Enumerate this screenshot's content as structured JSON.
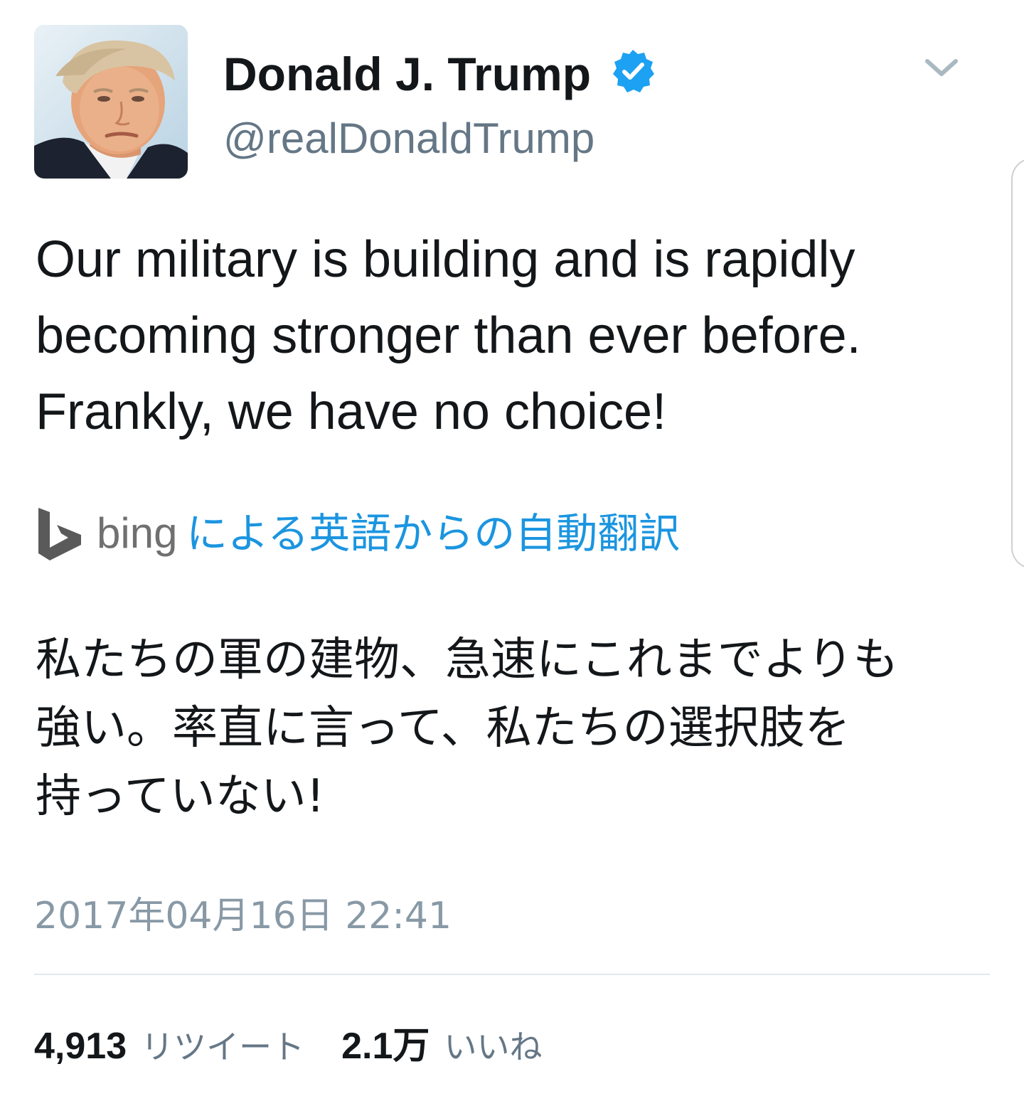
{
  "tweet": {
    "user": {
      "name": "Donald J. Trump",
      "handle": "@realDonaldTrump",
      "verified": true
    },
    "text_lines": [
      "Our military is building and is rapidly",
      "becoming stronger than ever before.",
      "Frankly, we have no choice!"
    ],
    "translation": {
      "provider": "bing",
      "link_label": "による英語からの自動翻訳",
      "text_lines": [
        "私たちの軍の建物、急速にこれまでよりも",
        "強い。率直に言って、私たちの選択肢を",
        "持っていない!"
      ]
    },
    "timestamp": "2017年04月16日 22:41",
    "stats": {
      "retweets": {
        "count": "4,913",
        "label": "リツイート"
      },
      "likes": {
        "count": "2.1万",
        "label": "いいね"
      }
    }
  },
  "colors": {
    "text_primary": "#14171a",
    "text_secondary": "#657786",
    "timestamp": "#8899a6",
    "link": "#1b95e0",
    "verified_badge": "#1da1f2",
    "divider": "#e1e8ed",
    "bing_gray": "#707070"
  },
  "icons": {
    "verified": "verified-badge-icon",
    "menu": "chevron-down-icon",
    "provider_logo": "bing-logo-icon"
  }
}
